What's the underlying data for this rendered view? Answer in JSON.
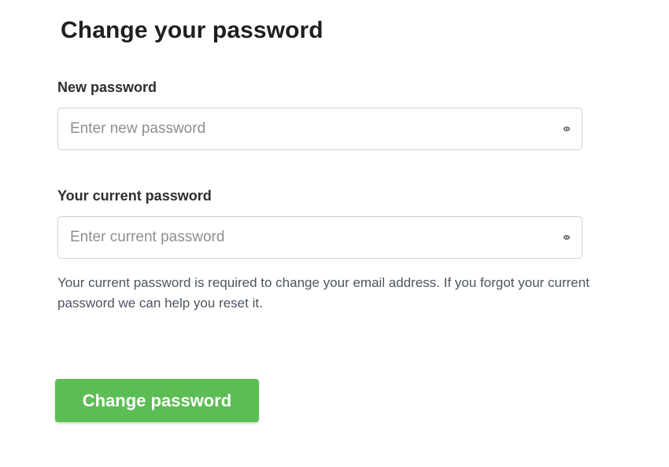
{
  "page": {
    "title": "Change your password"
  },
  "new_password": {
    "label": "New password",
    "value": "",
    "placeholder": "Enter new password",
    "toggle_icon": "eye-icon"
  },
  "current_password": {
    "label": "Your current password",
    "value": "",
    "placeholder": "Enter current password",
    "toggle_icon": "eye-icon"
  },
  "help": {
    "text": "Your current password is required to change your email address. If you forgot your current password we can help you reset it."
  },
  "actions": {
    "submit_label": "Change password"
  },
  "colors": {
    "primary_button": "#5cbd54",
    "border": "#cfd2d6",
    "help_text": "#4d5561"
  }
}
